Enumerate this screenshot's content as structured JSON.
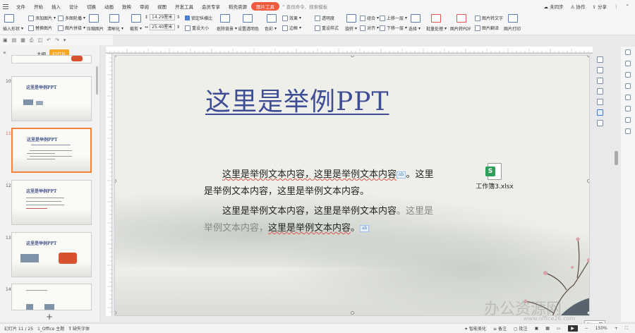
{
  "menubar": {
    "items": [
      "文件",
      "开始",
      "插入",
      "设计",
      "切换",
      "动画",
      "放映",
      "审阅",
      "视图",
      "开发工具",
      "会员专享",
      "稻壳资源",
      "图片工具"
    ],
    "active_index": 12,
    "search_placeholder": "查找命令、搜索模板",
    "right": {
      "sync": "未同步",
      "collab": "协作",
      "share": "分享"
    }
  },
  "ribbon": {
    "insert_dropdown": "插入形状",
    "add_picture": "添加图片",
    "replace_picture": "替换图片",
    "multi_crop": "多图轮播",
    "picture_combine": "图片拼接",
    "compress": "压缩图片",
    "clarity": "清晰化",
    "crop": "裁剪",
    "width_value": "14.29厘米",
    "height_value": "25.40厘米",
    "lock_ratio": "锁定纵横比",
    "reset_size": "重设大小",
    "remove_bg": "抠除背景",
    "set_transparent": "设置透明色",
    "color": "色彩",
    "effects": "效果",
    "border": "边框",
    "transparency": "透明度",
    "reset_style": "重设样式",
    "combine": "组合",
    "rotate": "旋转",
    "align": "对齐",
    "bring_forward": "上移一层",
    "send_backward": "下移一层",
    "select": "选择",
    "batch": "批量处理",
    "to_pdf": "图片转PDF",
    "to_text": "图片转文字",
    "translate": "图片翻译",
    "print": "图片打印"
  },
  "left_panel": {
    "tab_outline": "大纲",
    "tab_slides": "幻灯片",
    "thumbs": [
      {
        "num": "10",
        "title": "这里是举例PPT"
      },
      {
        "num": "11",
        "title": "这里是举例PPT",
        "selected": true
      },
      {
        "num": "12",
        "title": "这里是举例PPT"
      },
      {
        "num": "13",
        "title": "这里是举例PPT"
      },
      {
        "num": "14",
        "title": ""
      }
    ],
    "add_slide": "+"
  },
  "slide": {
    "title": "这里是举例PPT",
    "p1_a": "这里是举例文本内容，这里是举例文本内容",
    "p1_b": "。这里是举例文本内容，这里是举例文本内容。",
    "p2_a": "这里是举例文本内容，这里是举例文本内容",
    "p2_b": "。这里是举例文本内容，",
    "p2_c": "这里是举例文本内容",
    "p2_d": "。",
    "tag1": "ab",
    "tag2": "ab",
    "attachment_icon": "S",
    "attachment_name": "工作簿3.xlsx",
    "watermark": "办公资源网",
    "watermark_url": "www.office26.com",
    "lang_tag": "CH ⊿ 简"
  },
  "statusbar": {
    "slide_pos": "幻灯片 11 / 25",
    "theme": "1_Office 主题",
    "font_missing": "缺失字体",
    "smart_beautify": "智能美化",
    "notes": "备注",
    "comments": "批注",
    "zoom": "150%"
  },
  "colors": {
    "accent": "#f15a3c",
    "title": "#3e4d96",
    "selected_thumb": "#f0843c"
  }
}
